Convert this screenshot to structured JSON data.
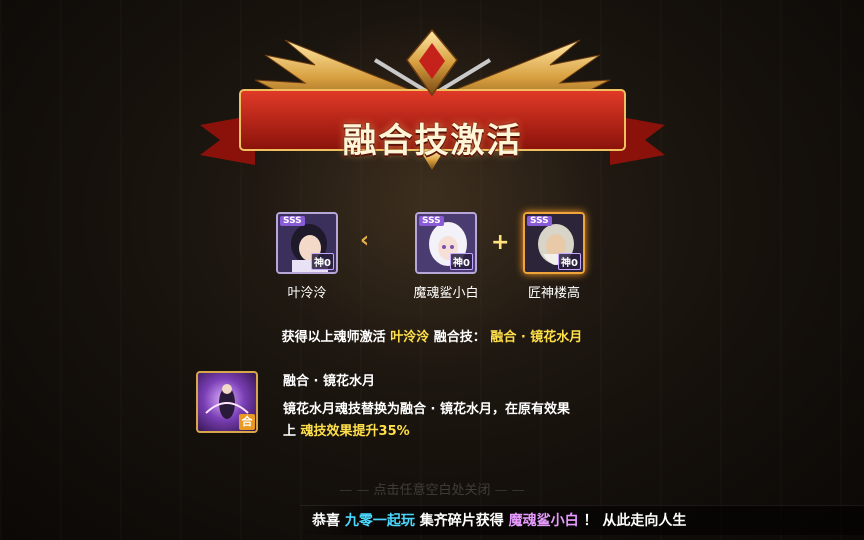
{
  "banner": {
    "title": "融合技激活"
  },
  "heroes": [
    {
      "name": "叶泠泠",
      "tier": "神0",
      "rank": "SSS"
    },
    {
      "name": "魔魂鲨小白",
      "tier": "神0",
      "rank": "SSS"
    },
    {
      "name": "匠神楼高",
      "tier": "神0",
      "rank": "SSS"
    }
  ],
  "connectors": {
    "arrow": "‹",
    "plus": "+"
  },
  "activate": {
    "prefix": "获得以上魂师激活",
    "hero": "叶泠泠",
    "middle": "融合技：",
    "skill": "融合 · 镜花水月"
  },
  "skill": {
    "tag": "合",
    "name": "融合 · 镜花水月",
    "desc_line1": "镜花水月魂技替换为融合 · 镜花水月，在原有效果",
    "desc_prefix": "上",
    "desc_highlight": "魂技效果提升35%"
  },
  "close_hint": {
    "text": "点击任意空白处关闭",
    "dash": "— —"
  },
  "marquee": {
    "prefix": "恭喜",
    "user": "九零一起玩",
    "middle": "集齐碎片获得",
    "item": "魔魂鲨小白",
    "suffix": "！ 从此走向人生"
  },
  "colors": {
    "highlight": "#ffe04a",
    "user": "#4ad8ff",
    "item": "#e79bff",
    "banner_red": "#b31e14",
    "gold": "#e8b24a"
  }
}
